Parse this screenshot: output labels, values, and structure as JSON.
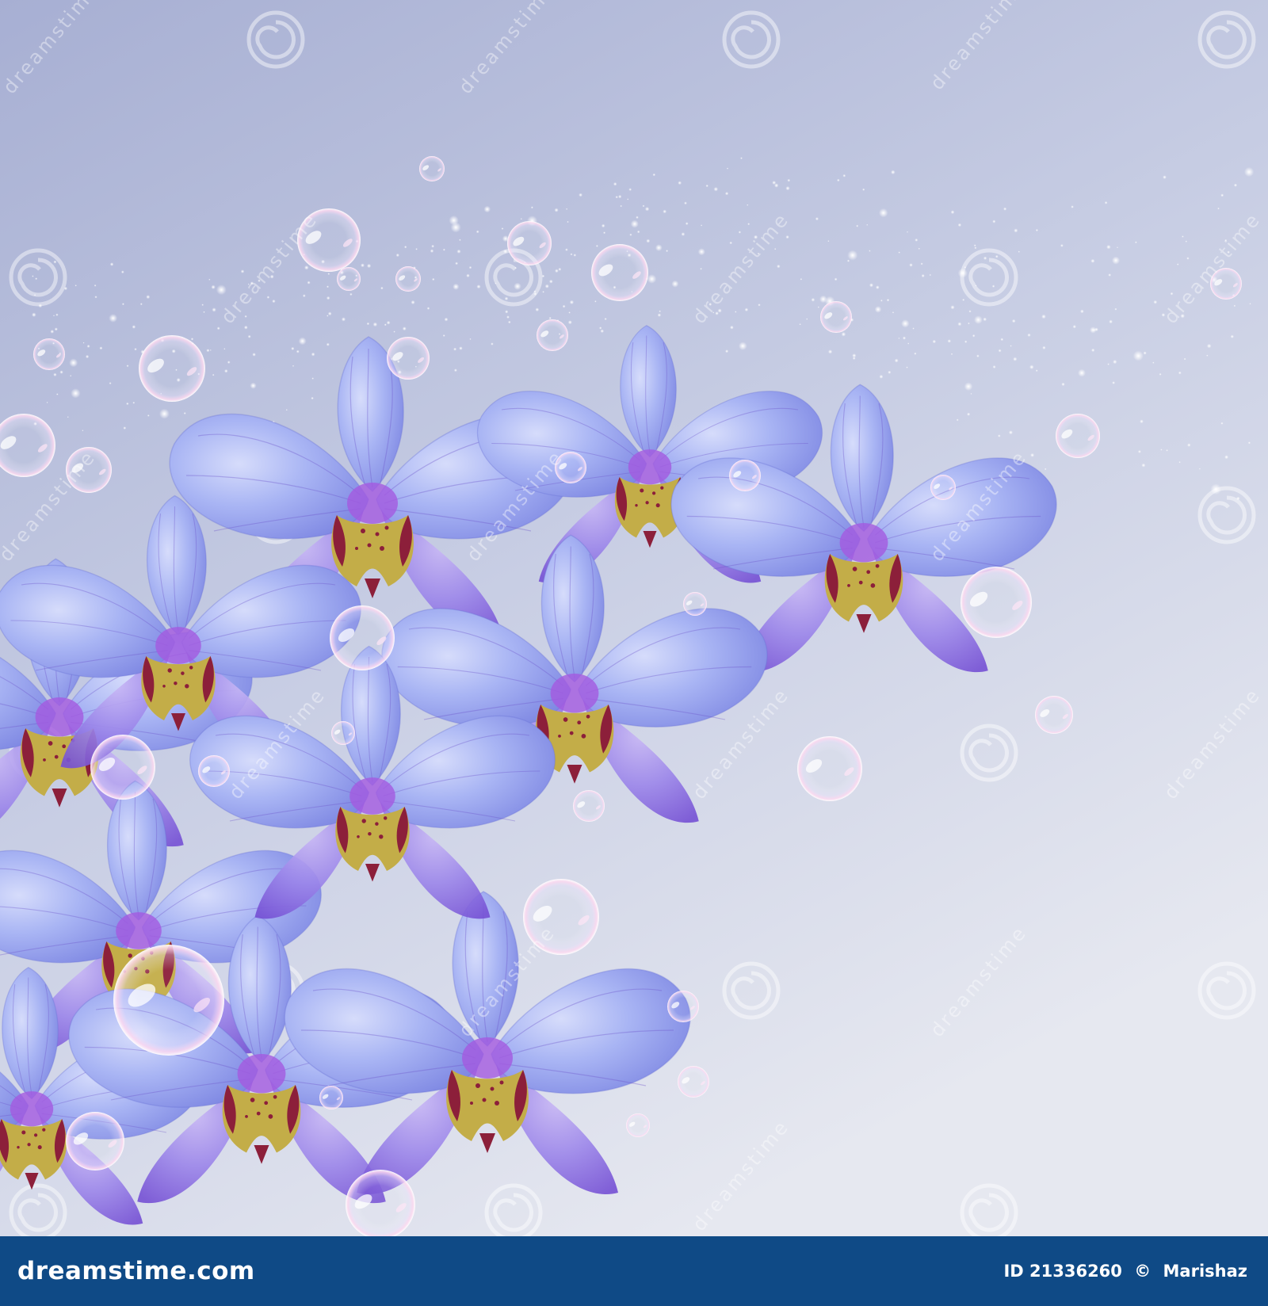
{
  "watermark": {
    "brand": "dreamstime.com",
    "repeated_mark": "dreamstime",
    "logo_icon": "spiral-watermark-icon"
  },
  "footer": {
    "brand_text": "dreamstime.com",
    "image_id": "ID 21336260",
    "copyright_symbol": "©",
    "author": "Marishaz"
  },
  "colors": {
    "background_top": "#a9b1d4",
    "background_bottom": "#e4e7f0",
    "petal_light": "#b8c4f4",
    "petal_mid": "#8a98e8",
    "petal_vein": "#7a4fd0",
    "column_yellow": "#c9b24a",
    "column_red": "#8c1f3a",
    "footer_bar": "#0f4a86",
    "footer_text": "#ffffff"
  }
}
